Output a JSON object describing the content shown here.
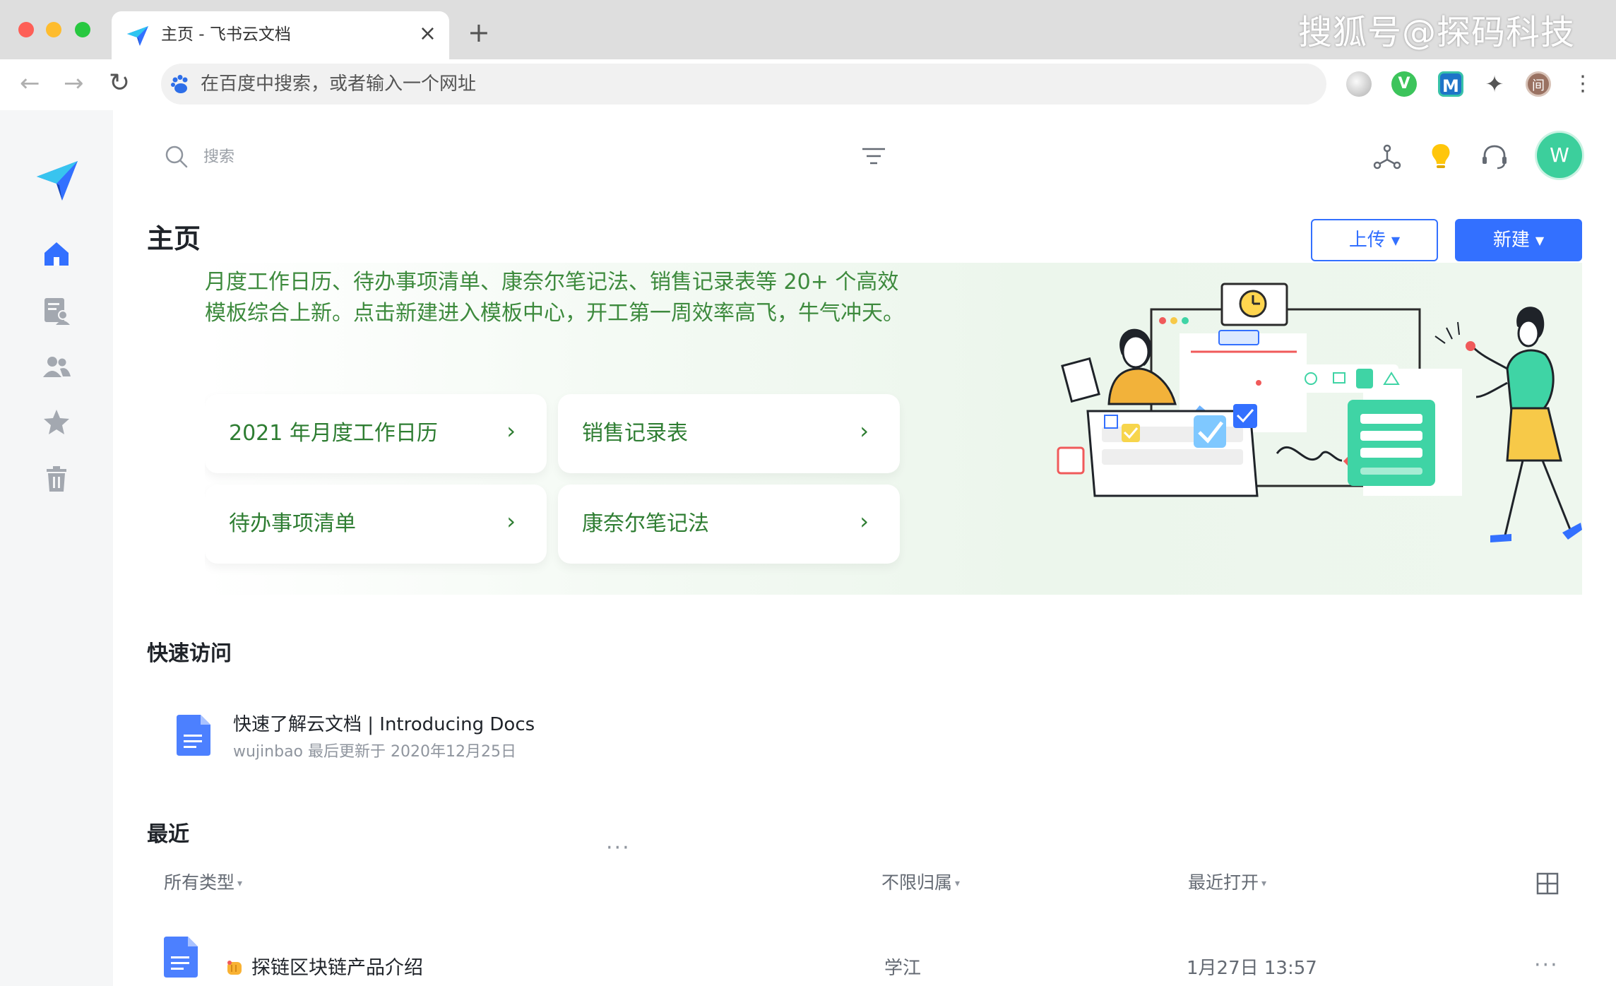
{
  "browser": {
    "tab_title": "主页 - 飞书云文档",
    "tab_close": "×",
    "new_tab": "+",
    "omnibox_placeholder": "在百度中搜索，或者输入一个网址",
    "watermark": "搜狐号@探码科技",
    "back": "←",
    "forward": "→",
    "reload": "↻",
    "ext_v": "V",
    "ext_m": "M",
    "ext_puzzle": "✦",
    "ext_profile": "间",
    "menu": "⋮"
  },
  "topbar": {
    "search_placeholder": "搜索",
    "avatar_initial": "W"
  },
  "header": {
    "title": "主页",
    "upload_label": "上传",
    "new_label": "新建",
    "caret": "▼"
  },
  "banner": {
    "text": "月度工作日历、待办事项清单、康奈尔笔记法、销售记录表等 20+ 个高效模板综合上新。点击新建进入模板中心，开工第一周效率高飞，牛气冲天。",
    "arrow": "›",
    "templates": [
      {
        "label": "2021 年月度工作日历"
      },
      {
        "label": "销售记录表"
      },
      {
        "label": "待办事项清单"
      },
      {
        "label": "康奈尔笔记法"
      }
    ]
  },
  "quick_access": {
    "title": "快速访问",
    "items": [
      {
        "title": "快速了解云文档 | Introducing Docs",
        "meta": "wujinbao 最后更新于 2020年12月25日"
      }
    ],
    "more": "···"
  },
  "recent": {
    "title": "最近",
    "filters": {
      "type": "所有类型",
      "owner": "不限归属",
      "sort": "最近打开",
      "tri": "▾"
    },
    "rows": [
      {
        "title": "探链区块链产品介绍",
        "owner": "学江",
        "time": "1月27日 13:57"
      }
    ],
    "more": "···"
  },
  "colors": {
    "brand_blue": "#3370ff",
    "banner_green": "#2e7d32",
    "avatar_green": "#3ccf9c"
  }
}
